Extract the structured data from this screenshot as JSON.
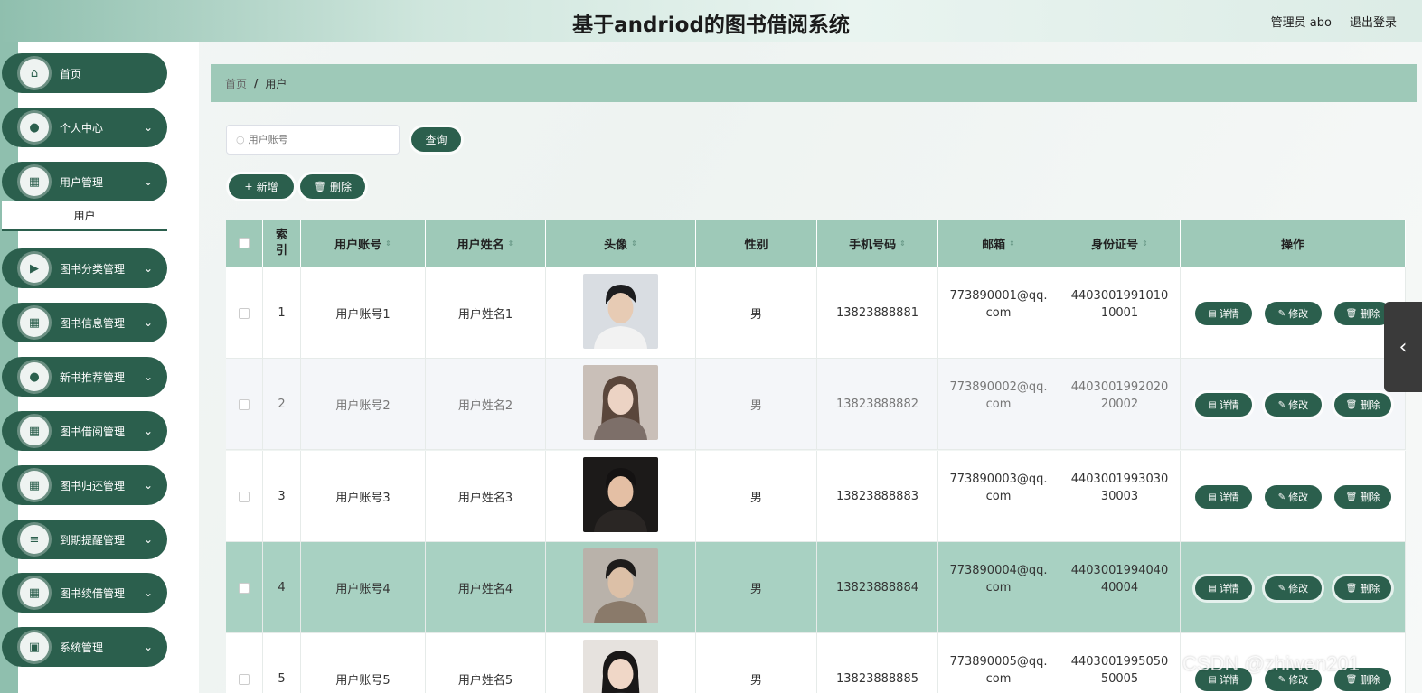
{
  "header": {
    "title": "基于andriod的图书借阅系统",
    "admin": "管理员 abo",
    "logout": "退出登录"
  },
  "sidebar": {
    "items": [
      {
        "label": "首页",
        "icon": "home-icon",
        "glyph": "⌂",
        "expandable": false
      },
      {
        "label": "个人中心",
        "icon": "user-icon",
        "glyph": "●",
        "expandable": true
      },
      {
        "label": "用户管理",
        "icon": "grid-icon",
        "glyph": "▦",
        "expandable": true
      },
      {
        "label": "图书分类管理",
        "icon": "video-icon",
        "glyph": "▶",
        "expandable": true
      },
      {
        "label": "图书信息管理",
        "icon": "grid-icon",
        "glyph": "▦",
        "expandable": true
      },
      {
        "label": "新书推荐管理",
        "icon": "user-icon",
        "glyph": "●",
        "expandable": true
      },
      {
        "label": "图书借阅管理",
        "icon": "grid-icon",
        "glyph": "▦",
        "expandable": true
      },
      {
        "label": "图书归还管理",
        "icon": "grid-icon",
        "glyph": "▦",
        "expandable": true
      },
      {
        "label": "到期提醒管理",
        "icon": "list-icon",
        "glyph": "≡",
        "expandable": true
      },
      {
        "label": "图书续借管理",
        "icon": "grid-icon",
        "glyph": "▦",
        "expandable": true
      },
      {
        "label": "系统管理",
        "icon": "clipboard-icon",
        "glyph": "▣",
        "expandable": true
      }
    ],
    "submenu_active": "用户"
  },
  "breadcrumb": {
    "home": "首页",
    "sep": "/",
    "current": "用户"
  },
  "search": {
    "placeholder": "用户账号",
    "query_label": "查询"
  },
  "toolbar": {
    "add_label": "新增",
    "delete_label": "删除"
  },
  "table": {
    "columns": [
      "索引",
      "用户账号",
      "用户姓名",
      "头像",
      "性别",
      "手机号码",
      "邮箱",
      "身份证号",
      "操作"
    ],
    "rows": [
      {
        "index": "1",
        "account": "用户账号1",
        "name": "用户姓名1",
        "gender": "男",
        "phone": "13823888881",
        "email": "773890001@qq.com",
        "id_card": "440300199101010001"
      },
      {
        "index": "2",
        "account": "用户账号2",
        "name": "用户姓名2",
        "gender": "男",
        "phone": "13823888882",
        "email": "773890002@qq.com",
        "id_card": "440300199202020002"
      },
      {
        "index": "3",
        "account": "用户账号3",
        "name": "用户姓名3",
        "gender": "男",
        "phone": "13823888883",
        "email": "773890003@qq.com",
        "id_card": "440300199303030003"
      },
      {
        "index": "4",
        "account": "用户账号4",
        "name": "用户姓名4",
        "gender": "男",
        "phone": "13823888884",
        "email": "773890004@qq.com",
        "id_card": "440300199404040004"
      },
      {
        "index": "5",
        "account": "用户账号5",
        "name": "用户姓名5",
        "gender": "男",
        "phone": "13823888885",
        "email": "773890005@qq.com",
        "id_card": "440300199505050005"
      }
    ],
    "actions": {
      "detail": "详情",
      "edit": "修改",
      "delete": "删除"
    }
  },
  "watermark": "CSDN @zhiwen201",
  "colors": {
    "primary": "#2b5f4d",
    "header_bg": "#9ec9b8",
    "highlight_row": "#a8d1c2"
  }
}
